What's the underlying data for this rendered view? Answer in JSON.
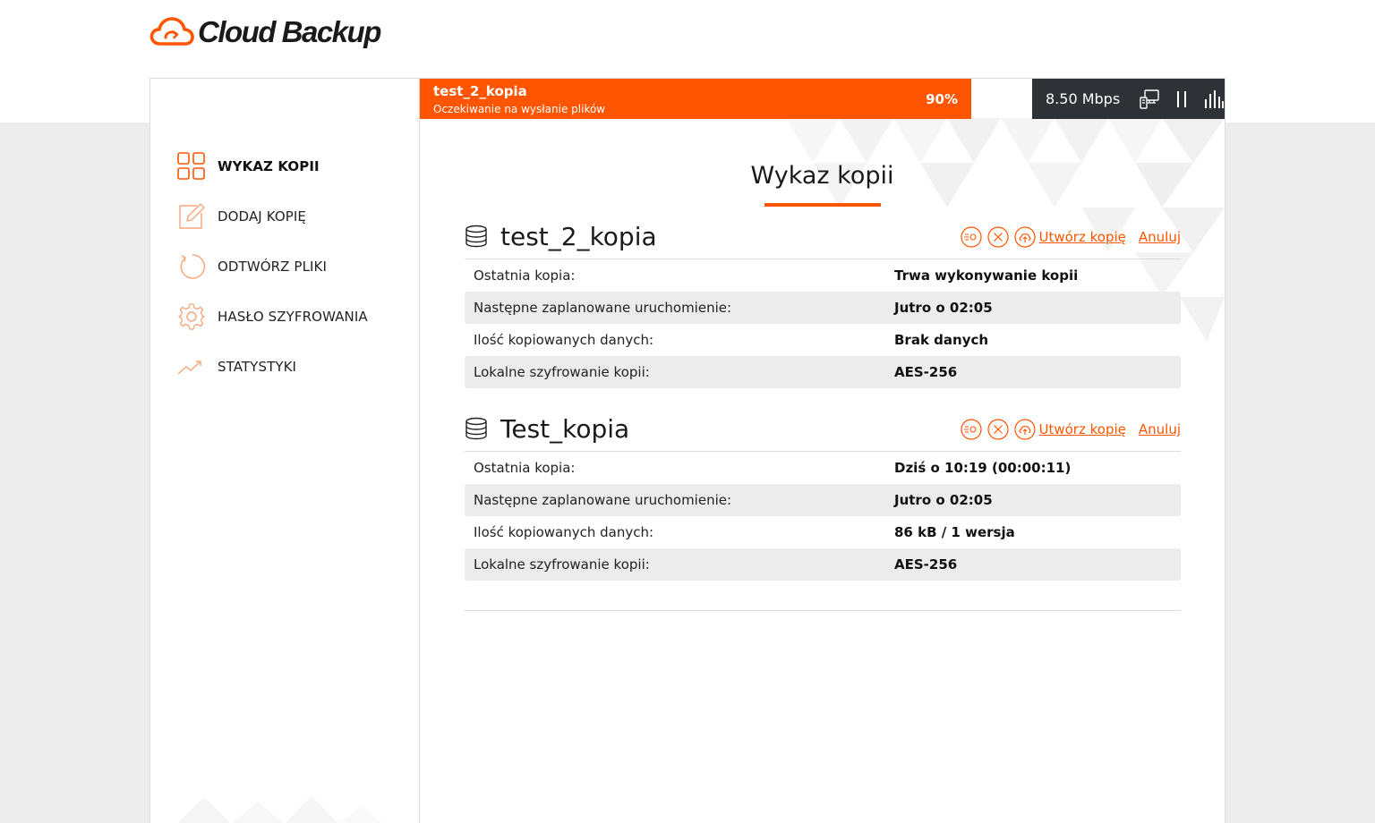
{
  "app": {
    "logo_text": "Cloud Backup",
    "accent": "#ff5500",
    "dark": "#2e3236"
  },
  "sidebar": {
    "items": [
      {
        "label": "WYKAZ KOPII",
        "icon": "grid-icon",
        "active": true
      },
      {
        "label": "DODAJ KOPIĘ",
        "icon": "edit-icon",
        "active": false
      },
      {
        "label": "ODTWÓRZ PLIKI",
        "icon": "restore-icon",
        "active": false
      },
      {
        "label": "HASŁO SZYFROWANIA",
        "icon": "gear-icon",
        "active": false
      },
      {
        "label": "STATYSTYKI",
        "icon": "trend-icon",
        "active": false
      }
    ]
  },
  "progress": {
    "name": "test_2_kopia",
    "status": "Oczekiwanie na wysłanie plików",
    "percent_label": "90%",
    "percent": 90
  },
  "speed": {
    "value": "8.50 Mbps"
  },
  "main": {
    "title": "Wykaz kopii"
  },
  "backups": [
    {
      "name": "test_2_kopia",
      "create_label": "Utwórz kopię",
      "cancel_label": "Anuluj",
      "rows": [
        {
          "label": "Ostatnia kopia:",
          "value": "Trwa wykonywanie kopii"
        },
        {
          "label": "Następne zaplanowane uruchomienie:",
          "value": "Jutro o 02:05"
        },
        {
          "label": "Ilość kopiowanych danych:",
          "value": "Brak danych"
        },
        {
          "label": "Lokalne szyfrowanie kopii:",
          "value": "AES-256"
        }
      ]
    },
    {
      "name": "Test_kopia",
      "create_label": "Utwórz kopię",
      "cancel_label": "Anuluj",
      "rows": [
        {
          "label": "Ostatnia kopia:",
          "value": "Dziś o 10:19 (00:00:11)"
        },
        {
          "label": "Następne zaplanowane uruchomienie:",
          "value": "Jutro o 02:05"
        },
        {
          "label": "Ilość kopiowanych danych:",
          "value": "86 kB / 1 wersja"
        },
        {
          "label": "Lokalne szyfrowanie kopii:",
          "value": "AES-256"
        }
      ]
    }
  ]
}
